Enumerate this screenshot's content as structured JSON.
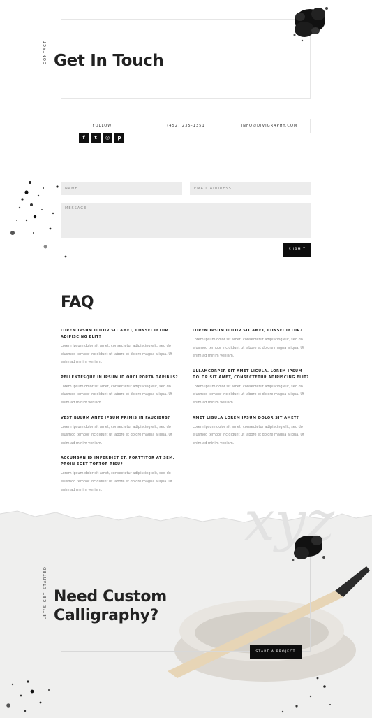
{
  "contact": {
    "eyebrow": "CONTACT",
    "title": "Get In Touch",
    "follow_label": "FOLLOW",
    "phone": "(452) 235-1351",
    "email": "INFO@DIVIGRAPHY.COM",
    "social": [
      {
        "name": "facebook-icon",
        "glyph": "f"
      },
      {
        "name": "twitter-icon",
        "glyph": "t"
      },
      {
        "name": "instagram-icon",
        "glyph": "◎"
      },
      {
        "name": "pinterest-icon",
        "glyph": "p"
      }
    ]
  },
  "form": {
    "name_placeholder": "NAME",
    "email_placeholder": "EMAIL ADDRESS",
    "message_placeholder": "MESSAGE",
    "submit_label": "SUBMIT"
  },
  "faq": {
    "title": "FAQ",
    "left": [
      {
        "q": "LOREM IPSUM DOLOR SIT AMET, CONSECTETUR ADIPISCING ELIT?",
        "a": "Lorem ipsum dolor sit amet, consectetur adipiscing elit, sed do eiusmod tempor incididunt ut labore et dolore magna aliqua. Ut enim ad minim veniam."
      },
      {
        "q": "PELLENTESQUE IN IPSUM ID ORCI PORTA DAPIBUS?",
        "a": "Lorem ipsum dolor sit amet, consectetur adipiscing elit, sed do eiusmod tempor incididunt ut labore et dolore magna aliqua. Ut enim ad minim veniam."
      },
      {
        "q": "VESTIBULUM ANTE IPSUM PRIMIS IN FAUCIBUS?",
        "a": "Lorem ipsum dolor sit amet, consectetur adipiscing elit, sed do eiusmod tempor incididunt ut labore et dolore magna aliqua. Ut enim ad minim veniam."
      },
      {
        "q": "ACCUMSAN ID IMPERDIET ET, PORTTITOR AT SEM. PROIN EGET TORTOR RISU?",
        "a": "Lorem ipsum dolor sit amet, consectetur adipiscing elit, sed do eiusmod tempor incididunt ut labore et dolore magna aliqua. Ut enim ad minim veniam."
      }
    ],
    "right": [
      {
        "q": "LOREM IPSUM DOLOR SIT AMET, CONSECTETUR?",
        "a": "Lorem ipsum dolor sit amet, consectetur adipiscing elit, sed do eiusmod tempor incididunt ut labore et dolore magna aliqua. Ut enim ad minim veniam."
      },
      {
        "q": "ULLAMCORPER SIT AMET LIGULA. LOREM IPSUM DOLOR SIT AMET, CONSECTETUR ADIPISCING ELIT?",
        "a": "Lorem ipsum dolor sit amet, consectetur adipiscing elit, sed do eiusmod tempor incididunt ut labore et dolore magna aliqua. Ut enim ad minim veniam."
      },
      {
        "q": "AMET LIGULA LOREM IPSUM DOLOR SIT AMET?",
        "a": "Lorem ipsum dolor sit amet, consectetur adipiscing elit, sed do eiusmod tempor incididunt ut labore et dolore magna aliqua. Ut enim ad minim veniam."
      }
    ]
  },
  "cta": {
    "eyebrow": "LET'S GET STARTED",
    "title_line1": "Need Custom",
    "title_line2": "Calligraphy?",
    "button_label": "START A PROJECT",
    "watermark": "xyz"
  }
}
